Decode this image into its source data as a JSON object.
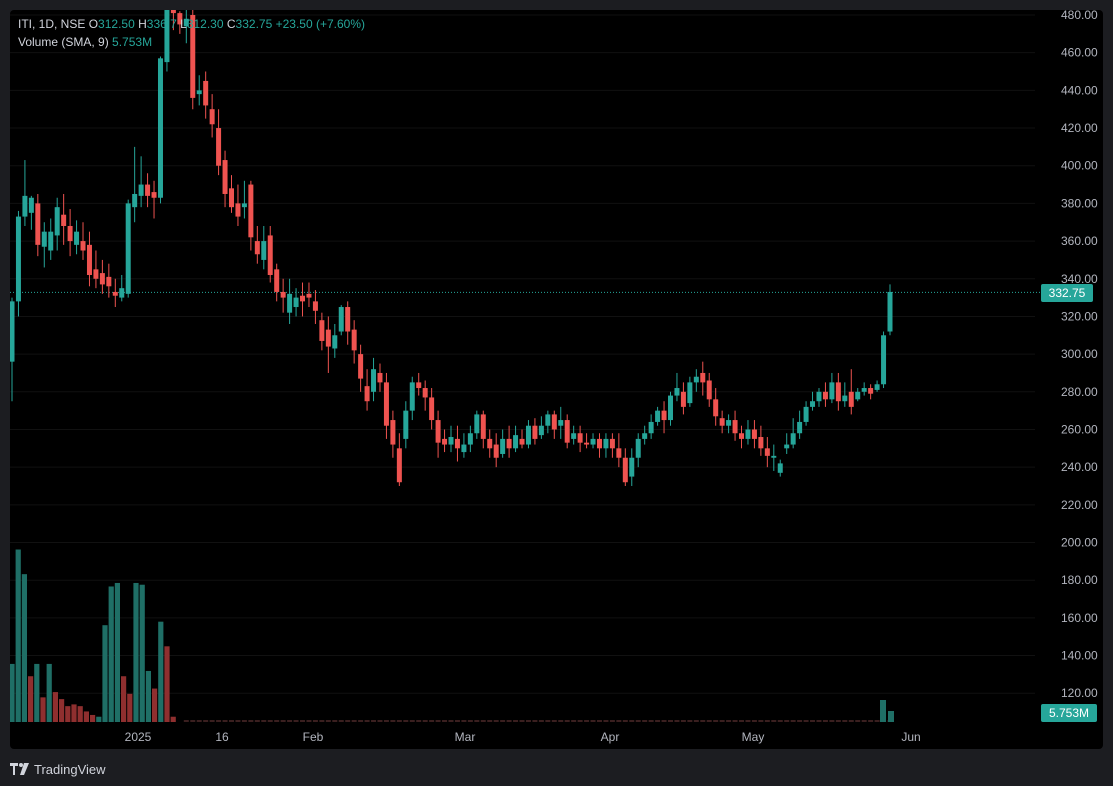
{
  "legend": {
    "symbol": "ITI, 1D, NSE",
    "o_label": "O",
    "o_value": "312.50",
    "h_label": "H",
    "h_value": "336.7",
    "l_label": "L",
    "l_value": "312.30",
    "c_label": "C",
    "c_value": "332.75",
    "change": "+23.50 (+7.60%)",
    "volume_label": "Volume (SMA, 9)",
    "volume_value": "5.753M"
  },
  "price_badge": "332.75",
  "volume_badge": "5.753M",
  "footer": {
    "brand": "TradingView"
  },
  "colors": {
    "up": "#26a69a",
    "down": "#ef5350",
    "up_vol": "#1f6f66",
    "down_vol": "#8f2f2f",
    "bg": "#000000",
    "axis_text": "#b2b5be"
  },
  "chart_data": {
    "type": "candlestick",
    "title": "ITI, 1D, NSE",
    "y_axis": {
      "ticks": [
        "480.00",
        "460.00",
        "440.00",
        "420.00",
        "400.00",
        "380.00",
        "360.00",
        "340.00",
        "320.00",
        "300.00",
        "280.00",
        "260.00",
        "240.00",
        "220.00",
        "200.00",
        "180.00",
        "160.00",
        "140.00",
        "120.00"
      ],
      "range": [
        110,
        482
      ]
    },
    "x_axis": {
      "labels": [
        "2025",
        "16",
        "Feb",
        "Mar",
        "Apr",
        "May",
        "Jun"
      ]
    },
    "last_price_line": 332.75,
    "candles": [
      [
        296,
        328,
        275,
        330
      ],
      [
        328,
        373,
        320,
        376
      ],
      [
        373,
        384,
        368,
        403
      ],
      [
        375,
        383,
        366,
        384
      ],
      [
        380,
        358,
        352,
        385
      ],
      [
        357,
        365,
        346,
        370
      ],
      [
        355,
        365,
        350,
        372
      ],
      [
        363,
        378,
        355,
        383
      ],
      [
        374,
        368,
        358,
        385
      ],
      [
        368,
        360,
        352,
        377
      ],
      [
        358,
        365,
        353,
        371
      ],
      [
        360,
        355,
        350,
        370
      ],
      [
        358,
        342,
        336,
        365
      ],
      [
        345,
        340,
        335,
        355
      ],
      [
        343,
        337,
        332,
        350
      ],
      [
        341,
        336,
        330,
        348
      ],
      [
        333,
        331,
        325,
        340
      ],
      [
        330,
        335,
        328,
        342
      ],
      [
        332,
        380,
        330,
        382
      ],
      [
        378,
        385,
        370,
        410
      ],
      [
        384,
        390,
        378,
        405
      ],
      [
        390,
        384,
        378,
        396
      ],
      [
        386,
        383,
        372,
        392
      ],
      [
        383,
        457,
        380,
        458
      ],
      [
        455,
        488,
        450,
        492
      ],
      [
        488,
        481,
        472,
        494
      ],
      [
        481,
        475,
        470,
        482
      ],
      [
        474,
        478,
        465,
        487
      ],
      [
        480,
        436,
        430,
        485
      ],
      [
        438,
        440,
        432,
        448
      ],
      [
        445,
        432,
        425,
        450
      ],
      [
        430,
        422,
        415,
        438
      ],
      [
        420,
        400,
        395,
        430
      ],
      [
        403,
        385,
        378,
        408
      ],
      [
        388,
        378,
        375,
        395
      ],
      [
        380,
        373,
        368,
        390
      ],
      [
        378,
        380,
        372,
        392
      ],
      [
        390,
        362,
        355,
        392
      ],
      [
        360,
        353,
        348,
        368
      ],
      [
        350,
        360,
        345,
        368
      ],
      [
        363,
        342,
        338,
        368
      ],
      [
        345,
        333,
        328,
        348
      ],
      [
        333,
        330,
        322,
        340
      ],
      [
        322,
        332,
        316,
        340
      ],
      [
        325,
        330,
        320,
        335
      ],
      [
        331,
        328,
        320,
        338
      ],
      [
        332,
        330,
        325,
        338
      ],
      [
        328,
        323,
        316,
        334
      ],
      [
        318,
        307,
        302,
        322
      ],
      [
        313,
        304,
        290,
        320
      ],
      [
        303,
        310,
        298,
        316
      ],
      [
        312,
        325,
        310,
        326
      ],
      [
        325,
        312,
        305,
        328
      ],
      [
        313,
        302,
        295,
        318
      ],
      [
        300,
        287,
        280,
        305
      ],
      [
        283,
        275,
        270,
        292
      ],
      [
        280,
        292,
        275,
        298
      ],
      [
        290,
        285,
        280,
        295
      ],
      [
        285,
        262,
        255,
        290
      ],
      [
        265,
        252,
        245,
        270
      ],
      [
        250,
        232,
        230,
        258
      ],
      [
        255,
        270,
        250,
        275
      ],
      [
        270,
        285,
        265,
        288
      ],
      [
        285,
        282,
        278,
        290
      ],
      [
        282,
        277,
        270,
        286
      ],
      [
        277,
        265,
        260,
        282
      ],
      [
        265,
        253,
        245,
        270
      ],
      [
        255,
        252,
        248,
        260
      ],
      [
        252,
        256,
        248,
        262
      ],
      [
        255,
        250,
        243,
        262
      ],
      [
        248,
        252,
        245,
        258
      ],
      [
        252,
        258,
        248,
        262
      ],
      [
        258,
        268,
        255,
        270
      ],
      [
        268,
        255,
        250,
        270
      ],
      [
        255,
        250,
        245,
        260
      ],
      [
        252,
        245,
        240,
        258
      ],
      [
        247,
        255,
        245,
        260
      ],
      [
        255,
        250,
        245,
        262
      ],
      [
        250,
        257,
        248,
        262
      ],
      [
        255,
        252,
        250,
        260
      ],
      [
        252,
        262,
        250,
        265
      ],
      [
        262,
        255,
        252,
        266
      ],
      [
        257,
        262,
        255,
        267
      ],
      [
        262,
        268,
        258,
        270
      ],
      [
        268,
        260,
        255,
        270
      ],
      [
        262,
        265,
        255,
        272
      ],
      [
        265,
        253,
        250,
        268
      ],
      [
        255,
        258,
        252,
        262
      ],
      [
        258,
        253,
        248,
        262
      ],
      [
        253,
        252,
        250,
        258
      ],
      [
        252,
        255,
        250,
        258
      ],
      [
        255,
        250,
        245,
        258
      ],
      [
        250,
        255,
        245,
        258
      ],
      [
        255,
        250,
        245,
        258
      ],
      [
        250,
        245,
        240,
        258
      ],
      [
        245,
        232,
        230,
        250
      ],
      [
        235,
        245,
        230,
        250
      ],
      [
        245,
        255,
        240,
        258
      ],
      [
        255,
        258,
        252,
        262
      ],
      [
        258,
        264,
        255,
        268
      ],
      [
        264,
        270,
        262,
        272
      ],
      [
        270,
        265,
        258,
        275
      ],
      [
        265,
        278,
        262,
        280
      ],
      [
        278,
        282,
        275,
        290
      ],
      [
        280,
        272,
        268,
        285
      ],
      [
        274,
        285,
        272,
        288
      ],
      [
        285,
        288,
        280,
        292
      ],
      [
        290,
        285,
        278,
        296
      ],
      [
        286,
        276,
        272,
        290
      ],
      [
        276,
        267,
        262,
        282
      ],
      [
        266,
        262,
        258,
        270
      ],
      [
        262,
        265,
        258,
        268
      ],
      [
        265,
        258,
        254,
        270
      ],
      [
        258,
        255,
        250,
        262
      ],
      [
        255,
        260,
        252,
        265
      ],
      [
        260,
        255,
        250,
        265
      ],
      [
        256,
        250,
        246,
        262
      ],
      [
        250,
        246,
        240,
        256
      ],
      [
        245,
        246,
        238,
        252
      ],
      [
        237,
        242,
        235,
        244
      ],
      [
        250,
        252,
        247,
        258
      ],
      [
        252,
        258,
        250,
        266
      ],
      [
        258,
        264,
        255,
        270
      ],
      [
        264,
        272,
        262,
        275
      ],
      [
        272,
        275,
        270,
        280
      ],
      [
        275,
        280,
        272,
        282
      ],
      [
        280,
        276,
        272,
        285
      ],
      [
        276,
        285,
        274,
        290
      ],
      [
        285,
        275,
        270,
        290
      ],
      [
        275,
        278,
        272,
        285
      ],
      [
        280,
        272,
        268,
        292
      ],
      [
        276,
        280,
        275,
        282
      ],
      [
        280,
        282,
        278,
        285
      ],
      [
        282,
        279,
        276,
        284
      ],
      [
        281,
        284,
        280,
        286
      ],
      [
        284,
        310,
        282,
        312
      ],
      [
        312,
        333,
        310,
        337
      ]
    ],
    "volumes": [
      [
        1,
        33
      ],
      [
        1,
        98
      ],
      [
        1,
        84
      ],
      [
        0,
        26
      ],
      [
        1,
        33
      ],
      [
        0,
        14
      ],
      [
        1,
        33
      ],
      [
        0,
        17
      ],
      [
        0,
        13
      ],
      [
        0,
        9
      ],
      [
        0,
        10
      ],
      [
        0,
        9
      ],
      [
        0,
        6
      ],
      [
        0,
        4
      ],
      [
        1,
        3
      ],
      [
        1,
        55
      ],
      [
        1,
        77
      ],
      [
        1,
        79
      ],
      [
        0,
        26
      ],
      [
        0,
        16
      ],
      [
        1,
        79
      ],
      [
        1,
        78
      ],
      [
        1,
        29
      ],
      [
        0,
        19
      ],
      [
        1,
        57
      ],
      [
        0,
        43
      ],
      [
        0,
        3
      ]
    ]
  }
}
